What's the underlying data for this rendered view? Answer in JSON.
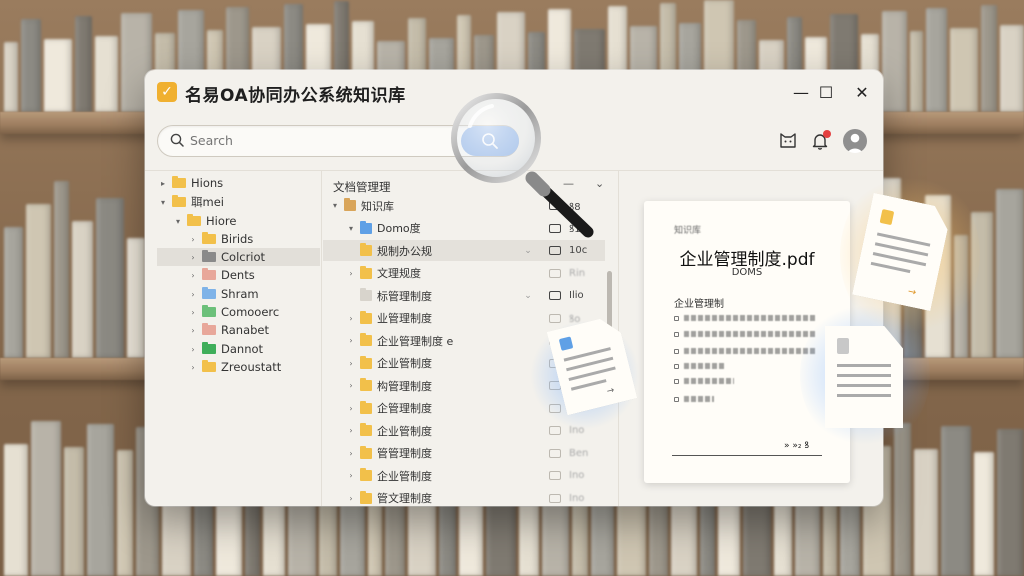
{
  "app": {
    "title": "名易OA协同办公系统知识库",
    "logo_glyph": "✓"
  },
  "window_controls": {
    "minimize": "—",
    "maximize": "☐",
    "close": "✕"
  },
  "search": {
    "placeholder": "Search"
  },
  "header_icons": [
    "cat-icon",
    "bell-icon",
    "avatar"
  ],
  "tree": {
    "items": [
      {
        "label": "Hions",
        "caret": "▸",
        "color": "#f2c04a",
        "indent": 0
      },
      {
        "label": "聑mei",
        "caret": "▾",
        "color": "#f2c04a",
        "indent": 0
      },
      {
        "label": "Hiore",
        "caret": "▾",
        "color": "#f2c04a",
        "indent": 1
      },
      {
        "label": "Birids",
        "caret": "›",
        "color": "#f2c04a",
        "indent": 2
      },
      {
        "label": "Colcriot",
        "caret": "›",
        "color": "#8a8a8a",
        "indent": 2
      },
      {
        "label": "Dents",
        "caret": "›",
        "color": "#e8a79a",
        "indent": 2
      },
      {
        "label": "Shram",
        "caret": "›",
        "color": "#7fb3e8",
        "indent": 2
      },
      {
        "label": "Comooerc",
        "caret": "›",
        "color": "#6cc07a",
        "indent": 2
      },
      {
        "label": "Ranabet",
        "caret": "›",
        "color": "#e8a79a",
        "indent": 2
      },
      {
        "label": "Dannot",
        "caret": "›",
        "color": "#3fae5a",
        "indent": 2
      },
      {
        "label": "Zreoustatt",
        "caret": "›",
        "color": "#f2c04a",
        "indent": 2
      }
    ]
  },
  "list": {
    "header": "文档管理理",
    "header_controls": [
      "—",
      "⌄"
    ],
    "rows": [
      {
        "caret": "▾",
        "name": "知识库",
        "color": "#d9a55a",
        "mark": "",
        "icon": "dark",
        "right": "ꝸ8",
        "indent": 0
      },
      {
        "caret": "▾",
        "name": "Domo度",
        "color": "#5fa0e6",
        "mark": "",
        "icon": "dark",
        "right": "ꝸ1",
        "indent": 1
      },
      {
        "caret": "",
        "name": "规制办公规",
        "color": "#f2c04a",
        "mark": "⌄",
        "icon": "dark",
        "right": "10c",
        "indent": 1
      },
      {
        "caret": "›",
        "name": "文理规度",
        "color": "#f2c04a",
        "mark": "",
        "icon": "light",
        "right": "Rin",
        "indent": 1
      },
      {
        "caret": "",
        "name": "标管理制度",
        "color": "#d8d4cc",
        "mark": "⌄",
        "icon": "dark",
        "right": "Ilio",
        "indent": 1
      },
      {
        "caret": "›",
        "name": "业管理制度",
        "color": "#f2c04a",
        "mark": "",
        "icon": "light",
        "right": "ꝸo",
        "indent": 1
      },
      {
        "caret": "›",
        "name": "企业管理制度 e",
        "color": "#f2c04a",
        "mark": "",
        "icon": "light",
        "right": "Ilo",
        "indent": 1
      },
      {
        "caret": "›",
        "name": "企业管制度",
        "color": "#f2c04a",
        "mark": "",
        "icon": "light",
        "right": "Ino",
        "indent": 1
      },
      {
        "caret": "›",
        "name": "构管理制度",
        "color": "#f2c04a",
        "mark": "",
        "icon": "light",
        "right": "Ino",
        "indent": 1
      },
      {
        "caret": "›",
        "name": "企管理制度",
        "color": "#f2c04a",
        "mark": "",
        "icon": "light",
        "right": "Ino",
        "indent": 1
      },
      {
        "caret": "›",
        "name": "企业管制度",
        "color": "#f2c04a",
        "mark": "",
        "icon": "light",
        "right": "Ino",
        "indent": 1
      },
      {
        "caret": "›",
        "name": "管管理制度",
        "color": "#f2c04a",
        "mark": "",
        "icon": "light",
        "right": "Ben",
        "indent": 1
      },
      {
        "caret": "›",
        "name": "企业管制度",
        "color": "#f2c04a",
        "mark": "",
        "icon": "light",
        "right": "Ino",
        "indent": 1
      },
      {
        "caret": "›",
        "name": "管文理制度",
        "color": "#f2c04a",
        "mark": "",
        "icon": "light",
        "right": "Ino",
        "indent": 1
      }
    ]
  },
  "preview": {
    "small_label": "知识库",
    "title": "企业管理制度.pdf",
    "subtitle": "DOMS",
    "section": "企业管理制",
    "footer": "» »₂ ꝸ"
  },
  "colors": {
    "accent": "#a8c4ec",
    "window_bg": "#f3f1ec",
    "selected_row": "#e2dfd9"
  }
}
